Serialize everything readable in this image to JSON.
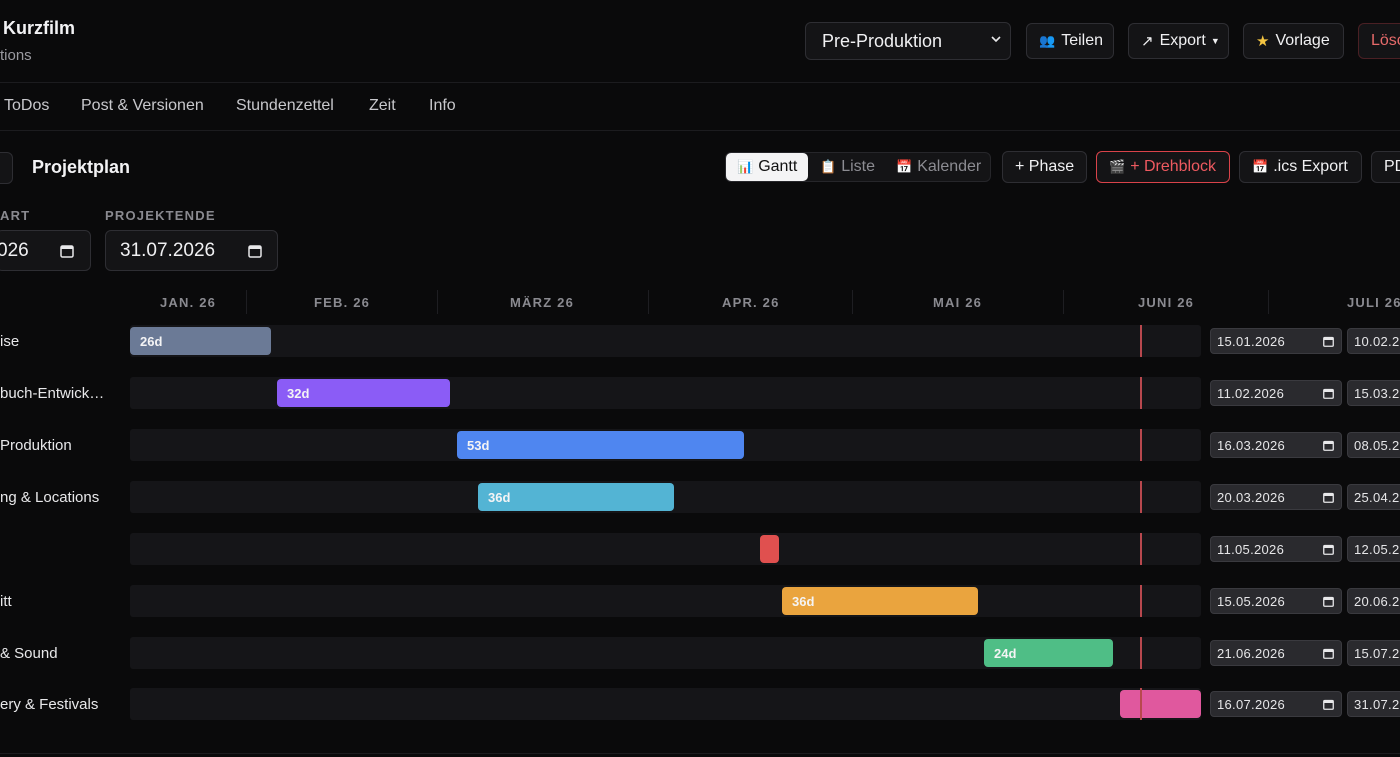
{
  "header": {
    "title": "Kurzfilm",
    "subtitle": "tions",
    "phase_select": "Pre-Produktion",
    "share_label": "Teilen",
    "export_label": "Export",
    "template_label": "Vorlage",
    "delete_label": "Lösc"
  },
  "tabs": [
    "ToDos",
    "Post & Versionen",
    "Stundenzettel",
    "Zeit",
    "Info"
  ],
  "toolbar": {
    "title": "Projektplan",
    "views": {
      "gantt": "Gantt",
      "list": "Liste",
      "calendar": "Kalender"
    },
    "add_phase": "+ Phase",
    "add_shootblock": "+ Drehblock",
    "ics_export": ".ics Export",
    "pdf": "PD"
  },
  "dates": {
    "start_label": "ART",
    "start_value": "026",
    "end_label": "PROJEKTENDE",
    "end_value": "31.07.2026"
  },
  "months": [
    "JAN. 26",
    "FEB. 26",
    "MÄRZ 26",
    "APR. 26",
    "MAI 26",
    "JUNI 26",
    "JULI 26"
  ],
  "phases": [
    {
      "label": "ise",
      "duration": "26d",
      "start": "15.01.2026",
      "end": "10.02.2",
      "color": "#6b7a96"
    },
    {
      "label": "buch-Entwick…",
      "duration": "32d",
      "start": "11.02.2026",
      "end": "15.03.2",
      "color": "#8b5cf6"
    },
    {
      "label": "Produktion",
      "duration": "53d",
      "start": "16.03.2026",
      "end": "08.05.2",
      "color": "#4f86f0"
    },
    {
      "label": "ng & Locations",
      "duration": "36d",
      "start": "20.03.2026",
      "end": "25.04.2",
      "color": "#53b4d4"
    },
    {
      "label": "",
      "duration": "",
      "start": "11.05.2026",
      "end": "12.05.2",
      "color": "#e0504f"
    },
    {
      "label": "itt",
      "duration": "36d",
      "start": "15.05.2026",
      "end": "20.06.2",
      "color": "#eaa43e"
    },
    {
      "label": "& Sound",
      "duration": "24d",
      "start": "21.06.2026",
      "end": "15.07.2",
      "color": "#4fbe86"
    },
    {
      "label": "ery & Festivals",
      "duration": "",
      "start": "16.07.2026",
      "end": "31.07.2",
      "color": "#e0589e"
    }
  ]
}
